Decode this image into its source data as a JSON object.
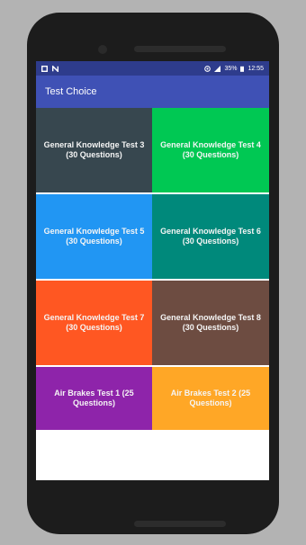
{
  "status_bar": {
    "battery": "35%",
    "time": "12:55",
    "left_icons": [
      "image-icon",
      "n-icon"
    ],
    "right_icons": [
      "location-icon",
      "signal-icon",
      "battery-icon"
    ]
  },
  "app_bar": {
    "title": "Test Choice"
  },
  "tiles": [
    {
      "label": "General Knowledge Test 3 (30 Questions)",
      "color": "#37474f"
    },
    {
      "label": "General Knowledge Test 4 (30 Questions)",
      "color": "#00c853"
    },
    {
      "label": "General Knowledge Test 5 (30 Questions)",
      "color": "#2196f3"
    },
    {
      "label": "General Knowledge Test 6 (30 Questions)",
      "color": "#00897b"
    },
    {
      "label": "General Knowledge Test 7 (30 Questions)",
      "color": "#ff5722"
    },
    {
      "label": "General Knowledge Test 8 (30 Questions)",
      "color": "#6d4c41"
    },
    {
      "label": "Air Brakes Test 1 (25 Questions)",
      "color": "#8e24aa"
    },
    {
      "label": "Air Brakes Test 2 (25 Questions)",
      "color": "#ffa726"
    }
  ]
}
